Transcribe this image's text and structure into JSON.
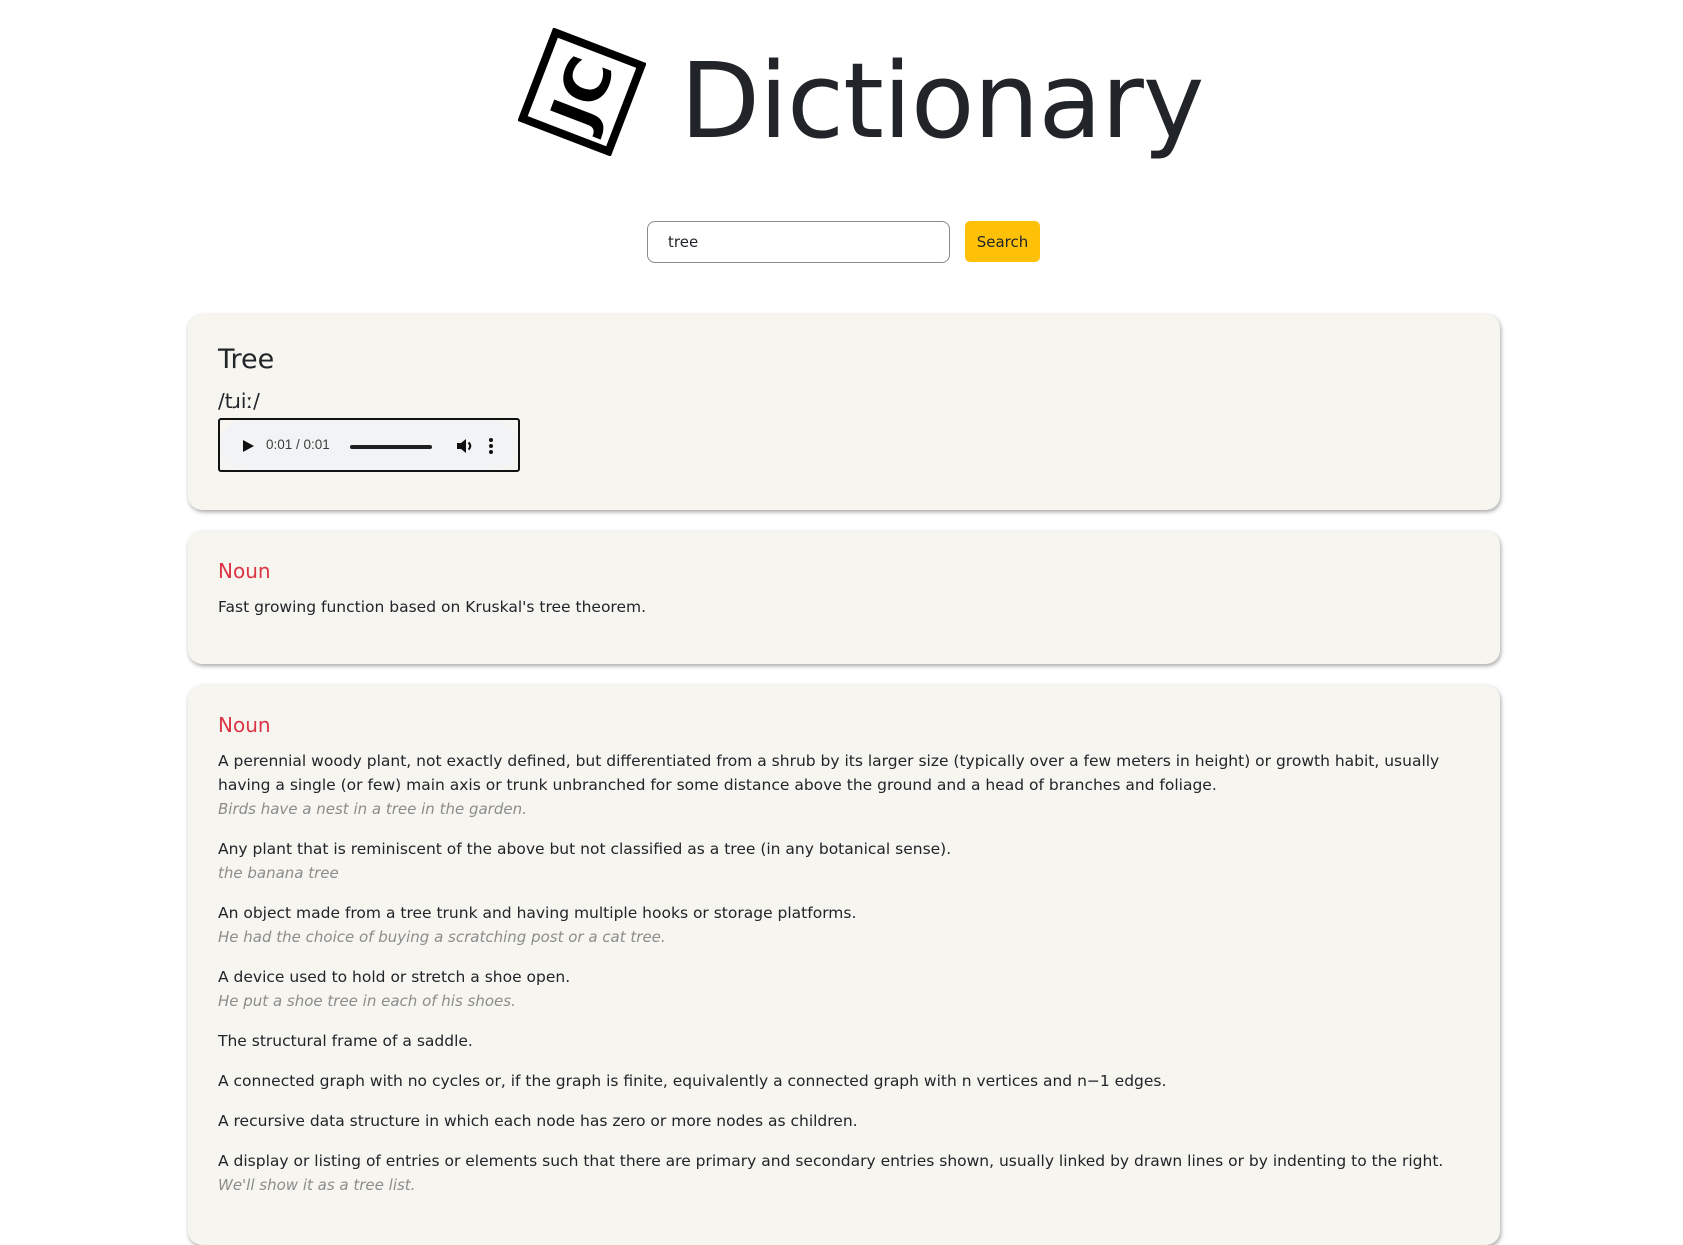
{
  "header": {
    "logo_icon": "jc-logo-icon",
    "logo_letters": "JC",
    "title": "Dictionary"
  },
  "search": {
    "value": "tree",
    "placeholder": "",
    "button_label": "Search",
    "button_color": "#ffc107"
  },
  "entry": {
    "word": "Tree",
    "phonetic": "/tɹiː/",
    "audio": {
      "current_time": "0:01",
      "duration": "0:01",
      "time_display": "0:01 / 0:01",
      "progress_percent": 100,
      "icons": {
        "play": "play-icon",
        "volume": "volume-icon",
        "more": "more-options-icon"
      }
    }
  },
  "meanings": [
    {
      "part_of_speech": "Noun",
      "definitions": [
        {
          "text": "Fast growing function based on Kruskal's tree theorem.",
          "example": ""
        }
      ]
    },
    {
      "part_of_speech": "Noun",
      "definitions": [
        {
          "text": "A perennial woody plant, not exactly defined, but differentiated from a shrub by its larger size (typically over a few meters in height) or growth habit, usually having a single (or few) main axis or trunk unbranched for some distance above the ground and a head of branches and foliage.",
          "example": "Birds have a nest in a tree in the garden."
        },
        {
          "text": "Any plant that is reminiscent of the above but not classified as a tree (in any botanical sense).",
          "example": "the banana tree"
        },
        {
          "text": "An object made from a tree trunk and having multiple hooks or storage platforms.",
          "example": "He had the choice of buying a scratching post or a cat tree."
        },
        {
          "text": "A device used to hold or stretch a shoe open.",
          "example": "He put a shoe tree in each of his shoes."
        },
        {
          "text": "The structural frame of a saddle.",
          "example": ""
        },
        {
          "text": "A connected graph with no cycles or, if the graph is finite, equivalently a connected graph with n vertices and n−1 edges.",
          "example": ""
        },
        {
          "text": "A recursive data structure in which each node has zero or more nodes as children.",
          "example": ""
        },
        {
          "text": "A display or listing of entries or elements such that there are primary and secondary entries shown, usually linked by drawn lines or by indenting to the right.",
          "example": "We'll show it as a tree list."
        }
      ]
    }
  ],
  "colors": {
    "card_background": "#f6f5ef",
    "part_of_speech": "#dc3545",
    "example_text": "#8c8c8c",
    "body_text": "#212529"
  }
}
